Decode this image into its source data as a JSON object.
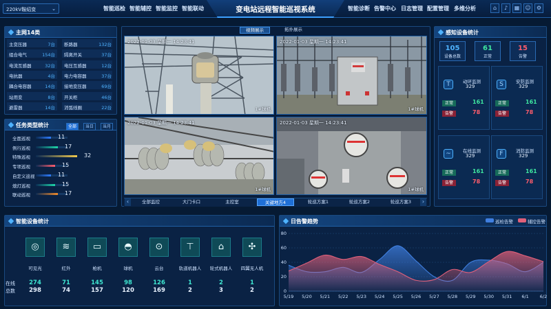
{
  "header": {
    "select_value": "220kV鞍绍变",
    "title": "变电站远程智能巡视系统",
    "left_nav": [
      "智能巡检",
      "智能辅控",
      "智能监控",
      "智能联动"
    ],
    "right_nav": [
      "智能诊断",
      "告警中心",
      "日志管理",
      "配置管理",
      "多维分析"
    ],
    "icons": [
      "home-icon",
      "bell-icon",
      "grid-icon",
      "user-icon",
      "settings-icon"
    ]
  },
  "main14": {
    "title": "主网14类",
    "left": [
      {
        "name": "主变压器",
        "value": "7台"
      },
      {
        "name": "组合电气",
        "value": "154台"
      },
      {
        "name": "电流互感器",
        "value": "32台"
      },
      {
        "name": "电抗器",
        "value": "4台"
      },
      {
        "name": "耦合电容器",
        "value": "14台"
      },
      {
        "name": "站用变",
        "value": "8台"
      },
      {
        "name": "避雷器",
        "value": "14台"
      }
    ],
    "right": [
      {
        "name": "断路器",
        "value": "132台"
      },
      {
        "name": "隔离开关",
        "value": "37台"
      },
      {
        "name": "电压互感器",
        "value": "12台"
      },
      {
        "name": "电力电容器",
        "value": "37台"
      },
      {
        "name": "接地变压器",
        "value": "69台"
      },
      {
        "name": "开关柜",
        "value": "46台"
      },
      {
        "name": "消弧线圈",
        "value": "22台"
      }
    ]
  },
  "task": {
    "title": "任务类型统计",
    "filters": [
      "全部",
      "当日",
      "当月"
    ],
    "items": [
      {
        "name": "全面巡视",
        "value": "11",
        "frac": 0.36,
        "color": "#2f7dff"
      },
      {
        "name": "例行巡视",
        "value": "17",
        "frac": 0.53,
        "color": "#1fd6a8"
      },
      {
        "name": "特殊巡视",
        "value": "32",
        "frac": 1.0,
        "color": "#f2c94c"
      },
      {
        "name": "专项巡视",
        "value": "15",
        "frac": 0.47,
        "color": "#ff5d6c"
      },
      {
        "name": "自定义巡视",
        "value": "11",
        "frac": 0.36,
        "color": "#2f7dff"
      },
      {
        "name": "熄灯巡视",
        "value": "15",
        "frac": 0.47,
        "color": "#1fd6a8"
      },
      {
        "name": "联动巡视",
        "value": "17",
        "frac": 0.53,
        "color": "#f08a2a"
      }
    ]
  },
  "video": {
    "tabs": [
      "视频展示",
      "拓扑展示"
    ],
    "cams": [
      {
        "ts": "2022-01-03 星期一 14:23:41",
        "label": "1#球机"
      },
      {
        "ts": "2022-01-03 星期一 14:23:41",
        "label": "1#球机"
      },
      {
        "ts": "2022-01-03 星期一 14:23:41",
        "label": "1#球机"
      },
      {
        "ts": "2022-01-03 星期一 14:23:41",
        "label": "1#球机"
      }
    ],
    "bottom_tabs": [
      "全部监控",
      "大门卡口",
      "主控室",
      "关键地方4",
      "轮巡方案1",
      "轮巡方案2",
      "轮巡方案3"
    ],
    "prev": "‹",
    "next": "›"
  },
  "sensing": {
    "title": "感知设备统计",
    "kpis": [
      {
        "value": "105",
        "label": "设备总数",
        "color": "#4fb3ff"
      },
      {
        "value": "61",
        "label": "正常",
        "color": "#3ee6a0"
      },
      {
        "value": "15",
        "label": "告警",
        "color": "#ff5d6c"
      }
    ],
    "cards": [
      {
        "title": "动环监测",
        "num": "329",
        "normal": "161",
        "alarm": "78",
        "icon": "thermometer-icon"
      },
      {
        "title": "安防监测",
        "num": "329",
        "normal": "161",
        "alarm": "78",
        "icon": "shield-icon"
      },
      {
        "title": "在线监测",
        "num": "329",
        "normal": "161",
        "alarm": "78",
        "icon": "monitor-icon"
      },
      {
        "title": "消防监测",
        "num": "329",
        "normal": "161",
        "alarm": "78",
        "icon": "hydrant-icon"
      }
    ],
    "normal_label": "正常",
    "alarm_label": "告警"
  },
  "devices": {
    "title": "智能设备统计",
    "row_labels": [
      "在线",
      "总数"
    ],
    "items": [
      {
        "name": "可见光",
        "online": "274",
        "total": "298",
        "icon": "camera-lens-icon"
      },
      {
        "name": "红外",
        "online": "71",
        "total": "74",
        "icon": "infrared-icon"
      },
      {
        "name": "枪机",
        "online": "145",
        "total": "157",
        "icon": "bullet-camera-icon"
      },
      {
        "name": "球机",
        "online": "98",
        "total": "120",
        "icon": "dome-camera-icon"
      },
      {
        "name": "云台",
        "online": "126",
        "total": "169",
        "icon": "ptz-icon"
      },
      {
        "name": "轨道机器人",
        "online": "1",
        "total": "2",
        "icon": "rail-robot-icon"
      },
      {
        "name": "轮式机器人",
        "online": "2",
        "total": "3",
        "icon": "wheeled-robot-icon"
      },
      {
        "name": "四翼无人机",
        "online": "1",
        "total": "2",
        "icon": "drone-icon"
      }
    ]
  },
  "trend": {
    "title": "日告警趋势",
    "legend": [
      "巡检告警",
      "辅控告警"
    ]
  },
  "chart_data": {
    "type": "area",
    "title": "日告警趋势",
    "categories": [
      "5/19",
      "5/20",
      "5/21",
      "5/22",
      "5/23",
      "5/24",
      "5/25",
      "5/26",
      "5/27",
      "5/28",
      "5/29",
      "5/30",
      "5/31",
      "6/1",
      "6/2"
    ],
    "yticks": [
      "0",
      "20",
      "40",
      "60",
      "80"
    ],
    "ylim": [
      0,
      80
    ],
    "grid": true,
    "legend_position": "top-right",
    "series": [
      {
        "name": "巡检告警",
        "color": "#3f7fe0",
        "values": [
          36,
          27,
          27,
          33,
          26,
          44,
          63,
          42,
          20,
          15,
          40,
          43,
          38,
          27,
          40
        ]
      },
      {
        "name": "辅控告警",
        "color": "#e0607a",
        "values": [
          28,
          39,
          50,
          44,
          48,
          37,
          27,
          15,
          16,
          30,
          26,
          41,
          55,
          49,
          41
        ]
      }
    ]
  }
}
